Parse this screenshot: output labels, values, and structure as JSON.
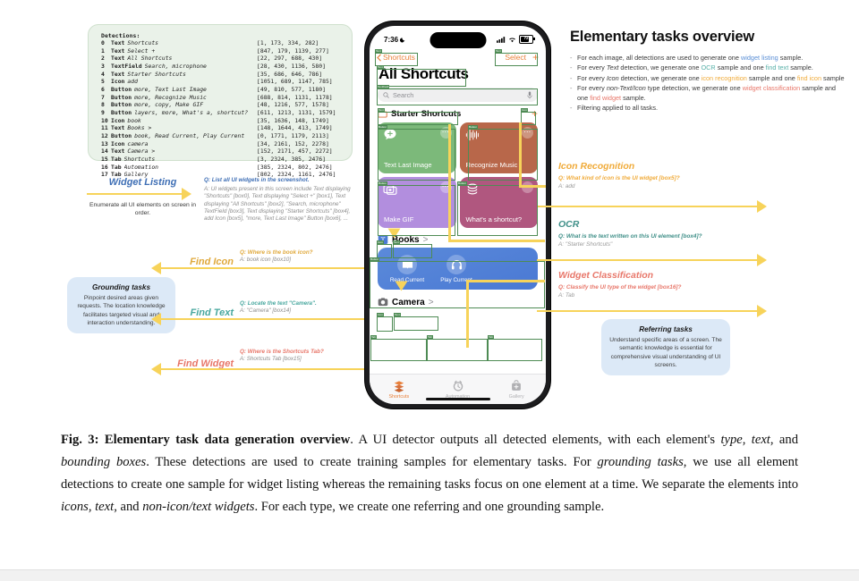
{
  "detections": {
    "title": "Detections:",
    "rows": [
      {
        "idx": "0",
        "type": "Text",
        "text": "Shortcuts",
        "box": "[1, 173, 334, 282]"
      },
      {
        "idx": "1",
        "type": "Text",
        "text": "Select +",
        "box": "[847, 179, 1139, 277]"
      },
      {
        "idx": "2",
        "type": "Text",
        "text": "All Shortcuts",
        "box": "[22, 297, 688, 430]"
      },
      {
        "idx": "3",
        "type": "TextField",
        "text": "Search, microphone",
        "box": "[28, 430, 1136, 580]"
      },
      {
        "idx": "4",
        "type": "Text",
        "text": "Starter Shortcuts",
        "box": "[35, 686, 646, 786]"
      },
      {
        "idx": "5",
        "type": "Icon",
        "text": "add",
        "box": "[1051, 689, 1147, 785]"
      },
      {
        "idx": "6",
        "type": "Button",
        "text": "more, Text Last Image",
        "box": "[49, 810, 577, 1180]"
      },
      {
        "idx": "7",
        "type": "Button",
        "text": "more, Recognize Music",
        "box": "[688, 814, 1131, 1178]"
      },
      {
        "idx": "8",
        "type": "Button",
        "text": "more, copy, Make GIF",
        "box": "[48, 1216, 577, 1578]"
      },
      {
        "idx": "9",
        "type": "Button",
        "text": "layers, more, What's a, shortcut?",
        "box": "[611, 1213, 1131, 1579]"
      },
      {
        "idx": "10",
        "type": "Icon",
        "text": "book",
        "box": "[35, 1636, 148, 1749]"
      },
      {
        "idx": "11",
        "type": "Text",
        "text": "Books >",
        "box": "[148, 1644, 413, 1749]"
      },
      {
        "idx": "12",
        "type": "Button",
        "text": "book, Read Current, Play Current",
        "box": "[0, 1771, 1179, 2113]"
      },
      {
        "idx": "13",
        "type": "Icon",
        "text": "camera",
        "box": "[34, 2161, 152, 2278]"
      },
      {
        "idx": "14",
        "type": "Text",
        "text": "Camera >",
        "box": "[152, 2171, 457, 2272]"
      },
      {
        "idx": "15",
        "type": "Tab",
        "text": "Shortcuts",
        "box": "[3, 2324, 385, 2476]"
      },
      {
        "idx": "16",
        "type": "Tab",
        "text": "Automation",
        "box": "[385, 2324, 802, 2476]"
      },
      {
        "idx": "17",
        "type": "Tab",
        "text": "Gallery",
        "box": "[802, 2324, 1161, 2476]"
      }
    ]
  },
  "left_tasks": {
    "widget_listing": {
      "label": "Widget Listing",
      "desc": "Enumerate all UI elements on screen in order.",
      "q": "Q: List all UI widgets in the screenshot.",
      "a": "A: UI widgets present in this screen include Text displaying \"Shortcuts\" [box0], Text displaying \"Select +\" [box1], Text displaying \"All Shortcuts\" [box2], \"Search, microphone\" TextField [box3], Text displaying \"Starter Shortcuts\" [box4], add Icon [box5], \"more, Text Last Image\" Button [box6], ..."
    },
    "grounding_card": {
      "title": "Grounding tasks",
      "body": "Pinpoint desired areas given requests. The location knowledge facilitates targeted visual and interaction understanding."
    },
    "find_icon": {
      "label": "Find Icon",
      "q": "Q: Where is the book icon?",
      "a": "A: book icon [box10]"
    },
    "find_text": {
      "label": "Find Text",
      "q": "Q: Locate the text \"Camera\".",
      "a": "A: \"Camera\" [box14]"
    },
    "find_widget": {
      "label": "Find Widget",
      "q": "Q: Where is the Shortcuts Tab?",
      "a": "A: Shortcuts Tab [box15]"
    }
  },
  "overview": {
    "title": "Elementary tasks overview",
    "bullets": [
      "For each image, all detections are used to generate one widget listing sample.",
      "For every Text detection, we generate one OCR sample and one find text sample.",
      "For every Icon detection, we generate one icon recognition sample and one find icon sample",
      "For every non-Text/Icon type detection, we generate one widget classification sample and one find widget sample.",
      "Filtering applied to all tasks."
    ]
  },
  "right_tasks": {
    "icon_recognition": {
      "label": "Icon Recognition",
      "q": "Q: What kind of icon is the UI widget [box5]?",
      "a": "A: add"
    },
    "ocr": {
      "label": "OCR",
      "q": "Q: What is the text written on this UI element [box4]?",
      "a": "A: \"Starter Shortcuts\""
    },
    "widget_classification": {
      "label": "Widget Classification",
      "q": "Q: Classify the UI type of the widget [box16]?",
      "a": "A: Tab"
    },
    "referring_card": {
      "title": "Referring tasks",
      "body": "Understand specific areas of a screen. The semantic knowledge is essential for comprehensive visual understanding of UI screens."
    }
  },
  "phone": {
    "status": {
      "time": "7:36",
      "battery": "72"
    },
    "nav": {
      "back": "Shortcuts",
      "select": "Select",
      "add": "+"
    },
    "page_title": "All Shortcuts",
    "search_placeholder": "Search",
    "section": {
      "title": "Starter Shortcuts",
      "add": "+"
    },
    "cards": [
      {
        "name": "Text Last Image",
        "color": "#7cb97a",
        "icon": "message-plus-icon"
      },
      {
        "name": "Recognize Music",
        "color": "#b8674a",
        "icon": "waveform-icon"
      },
      {
        "name": "Make GIF",
        "color": "#b28ede",
        "icon": "photos-icon"
      },
      {
        "name": "What's a shortcut?",
        "color": "#b0577f",
        "icon": "layers-icon"
      }
    ],
    "books": {
      "label": "Books",
      "chevron": ">"
    },
    "books_actions": [
      {
        "label": "Read Current",
        "icon": "book-icon"
      },
      {
        "label": "Play Current",
        "icon": "headphones-icon"
      }
    ],
    "camera": {
      "label": "Camera",
      "chevron": ">"
    },
    "tabs": [
      {
        "label": "Shortcuts",
        "icon": "shortcuts-icon",
        "active": true
      },
      {
        "label": "Automation",
        "icon": "clock-icon",
        "active": false
      },
      {
        "label": "Gallery",
        "icon": "gallery-icon",
        "active": false
      }
    ],
    "overlay_labels": {
      "text": "Text",
      "textfield": "TextField",
      "icon": "Icon",
      "button": "Button",
      "tab": "Tab"
    }
  },
  "caption": {
    "fig": "Fig. 3:",
    "bold_title": "Elementary task data generation overview",
    "body_1": ". A UI detector outputs all detected elements, with each element's ",
    "it_1": "type",
    "body_2": ", ",
    "it_2": "text",
    "body_3": ", and ",
    "it_3": "bounding boxes",
    "body_4": ". These detections are used to create training samples for elementary tasks. For ",
    "it_4": "grounding tasks",
    "body_5": ", we use all element detections to create one sample for widget listing whereas the remaining tasks focus on one element at a time. We separate the elements into ",
    "it_5": "icons",
    "body_6": ", ",
    "it_6": "text",
    "body_7": ", and ",
    "it_7": "non-icon/text widgets",
    "body_8": ". For each type, we create one referring and one grounding sample."
  },
  "colors": {
    "accent_yellow": "#f7d35a",
    "detections_bg": "#eaf2e9",
    "card_blue": "#dce9f7",
    "green_box": "#4e8b54",
    "orange": "#e8803a",
    "widget_listing": "#5b8fd6",
    "ocr": "#57b0a8",
    "icon_recognition": "#f0ab3a",
    "widget_classification": "#e8776a"
  }
}
